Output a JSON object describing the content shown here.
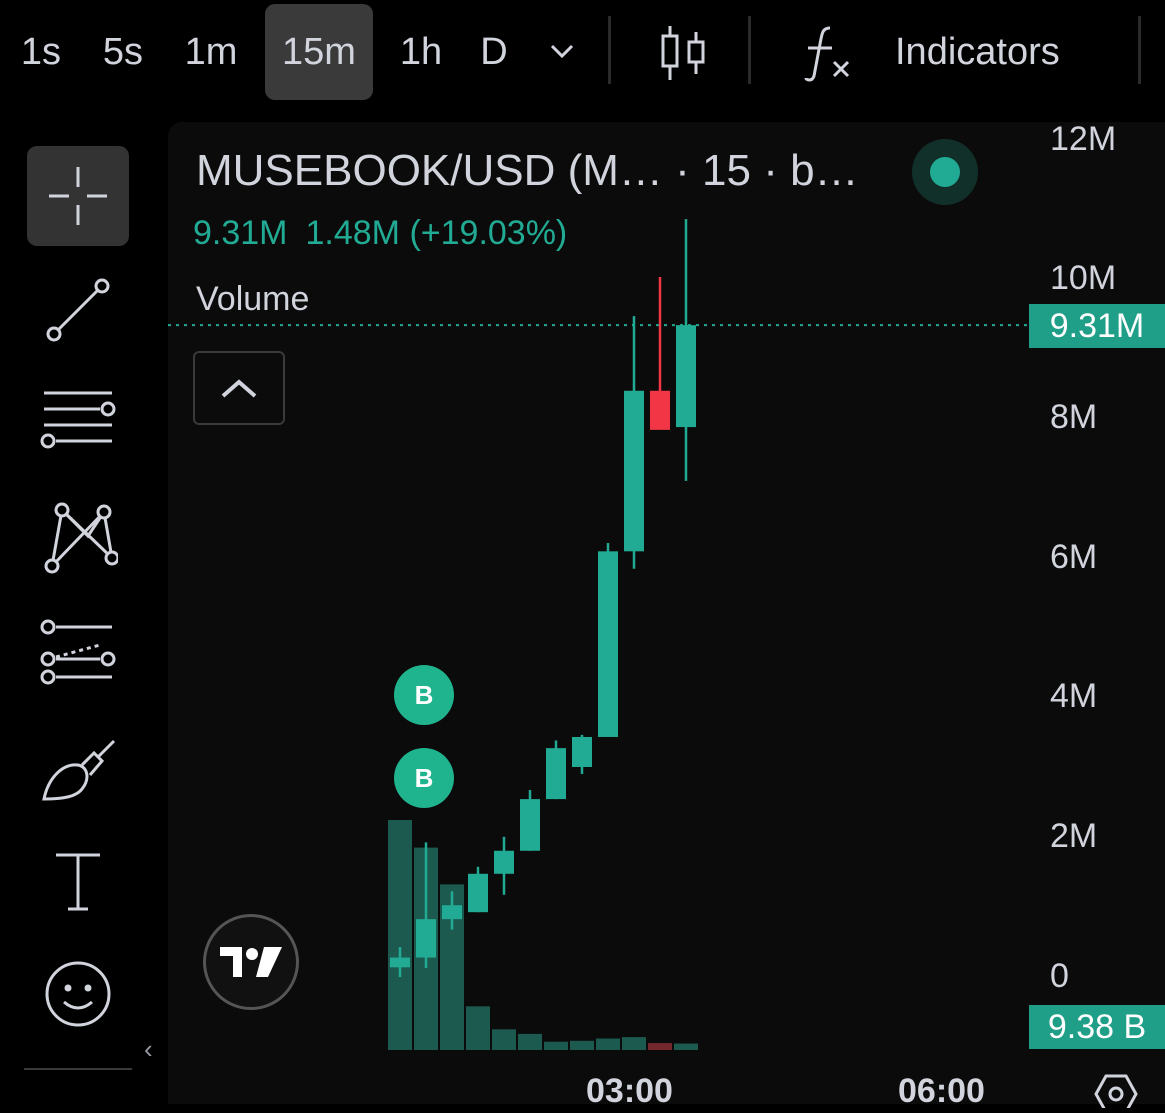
{
  "toolbar": {
    "timeframes": [
      "1s",
      "5s",
      "1m",
      "15m",
      "1h",
      "D"
    ],
    "active_timeframe": "15m",
    "indicators_label": "Indicators",
    "icons": [
      "chevron-down-icon",
      "candles-icon",
      "fx-icon"
    ]
  },
  "sidebar": {
    "tools": [
      "crosshair-icon",
      "trend-line-icon",
      "fib-lines-icon",
      "pattern-icon",
      "forecast-icon",
      "brush-icon",
      "text-icon",
      "emoji-icon"
    ],
    "collapse_glyph": "‹"
  },
  "legend": {
    "title": "MUSEBOOK/USD (M…  · 15 · b…",
    "close": "9.31M",
    "change": "1.48M (+19.03%)",
    "volume_label": "Volume"
  },
  "markers": [
    "B",
    "B"
  ],
  "price_tag": "9.31M",
  "volume_tag": "9.38 B",
  "colors": {
    "up": "#22ab94",
    "down": "#f23645",
    "tag": "#1f9e88",
    "bg": "#0b0b0b"
  },
  "chart_data": {
    "type": "candlestick",
    "yticks": [
      "0",
      "2M",
      "4M",
      "6M",
      "8M",
      "10M",
      "12M"
    ],
    "ylim": [
      0,
      12000000
    ],
    "xticks": [
      "03:00",
      "06:00"
    ],
    "candles": [
      {
        "o": 0.11,
        "h": 0.4,
        "l": -0.03,
        "c": 0.25,
        "v": 5.0
      },
      {
        "o": 0.25,
        "h": 1.9,
        "l": 0.1,
        "c": 0.8,
        "v": 4.4
      },
      {
        "o": 0.8,
        "h": 1.2,
        "l": 0.65,
        "c": 1.0,
        "v": 3.6
      },
      {
        "o": 0.9,
        "h": 1.55,
        "l": 0.9,
        "c": 1.45,
        "v": 0.95
      },
      {
        "o": 1.45,
        "h": 1.98,
        "l": 1.15,
        "c": 1.78,
        "v": 0.45
      },
      {
        "o": 1.78,
        "h": 2.65,
        "l": 1.78,
        "c": 2.52,
        "v": 0.35
      },
      {
        "o": 2.52,
        "h": 3.36,
        "l": 2.52,
        "c": 3.25,
        "v": 0.18
      },
      {
        "o": 2.98,
        "h": 3.44,
        "l": 2.88,
        "c": 3.41,
        "v": 0.2
      },
      {
        "o": 3.41,
        "h": 6.19,
        "l": 3.41,
        "c": 6.07,
        "v": 0.25
      },
      {
        "o": 6.07,
        "h": 9.44,
        "l": 5.82,
        "c": 8.37,
        "v": 0.28
      },
      {
        "o": 8.37,
        "h": 10.0,
        "l": 7.92,
        "c": 7.81,
        "v": 0.15
      },
      {
        "o": 7.85,
        "h": 10.83,
        "l": 7.08,
        "c": 9.31,
        "v": 0.14
      }
    ],
    "candle_units": "millions",
    "volume_units": "billions"
  }
}
